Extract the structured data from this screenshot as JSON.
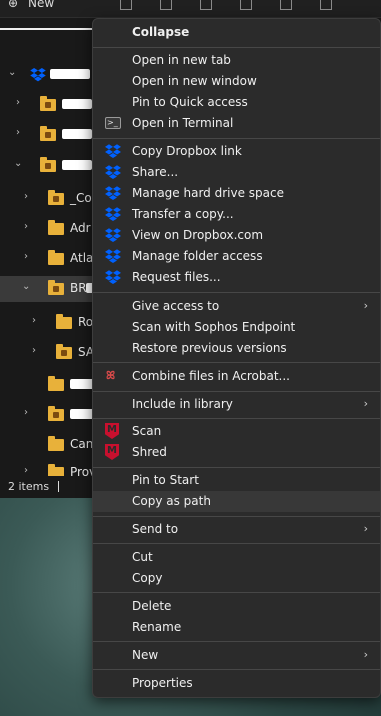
{
  "toolbar": {
    "new_label": "New"
  },
  "tree": {
    "items": [
      {
        "label": ""
      },
      {
        "label": ""
      },
      {
        "label": ""
      },
      {
        "label": ""
      },
      {
        "label": "_Co"
      },
      {
        "label": "Adr"
      },
      {
        "label": "Atla"
      },
      {
        "label": "BRC"
      },
      {
        "label": "Ro"
      },
      {
        "label": "SA"
      },
      {
        "label": ""
      },
      {
        "label": ""
      },
      {
        "label": "Can"
      },
      {
        "label": "Prov"
      }
    ]
  },
  "status": {
    "items_count": "2 items"
  },
  "menu": {
    "collapse": "Collapse",
    "open_new_tab": "Open in new tab",
    "open_new_window": "Open in new window",
    "pin_quick_access": "Pin to Quick access",
    "open_terminal": "Open in Terminal",
    "copy_dropbox_link": "Copy Dropbox link",
    "share": "Share...",
    "manage_hard_drive": "Manage hard drive space",
    "transfer_copy": "Transfer a copy...",
    "view_dropbox": "View on Dropbox.com",
    "manage_folder_access": "Manage folder access",
    "request_files": "Request files...",
    "give_access": "Give access to",
    "scan_sophos": "Scan with Sophos Endpoint",
    "restore_versions": "Restore previous versions",
    "combine_acrobat": "Combine files in Acrobat...",
    "include_library": "Include in library",
    "scan": "Scan",
    "shred": "Shred",
    "pin_start": "Pin to Start",
    "copy_as_path": "Copy as path",
    "send_to": "Send to",
    "cut": "Cut",
    "copy": "Copy",
    "delete": "Delete",
    "rename": "Rename",
    "new": "New",
    "properties": "Properties"
  },
  "colors": {
    "menu_bg": "#2b2b2b",
    "dropbox_blue": "#0061fe",
    "folder_yellow": "#e8b13a",
    "mcafee_red": "#c8102e"
  }
}
